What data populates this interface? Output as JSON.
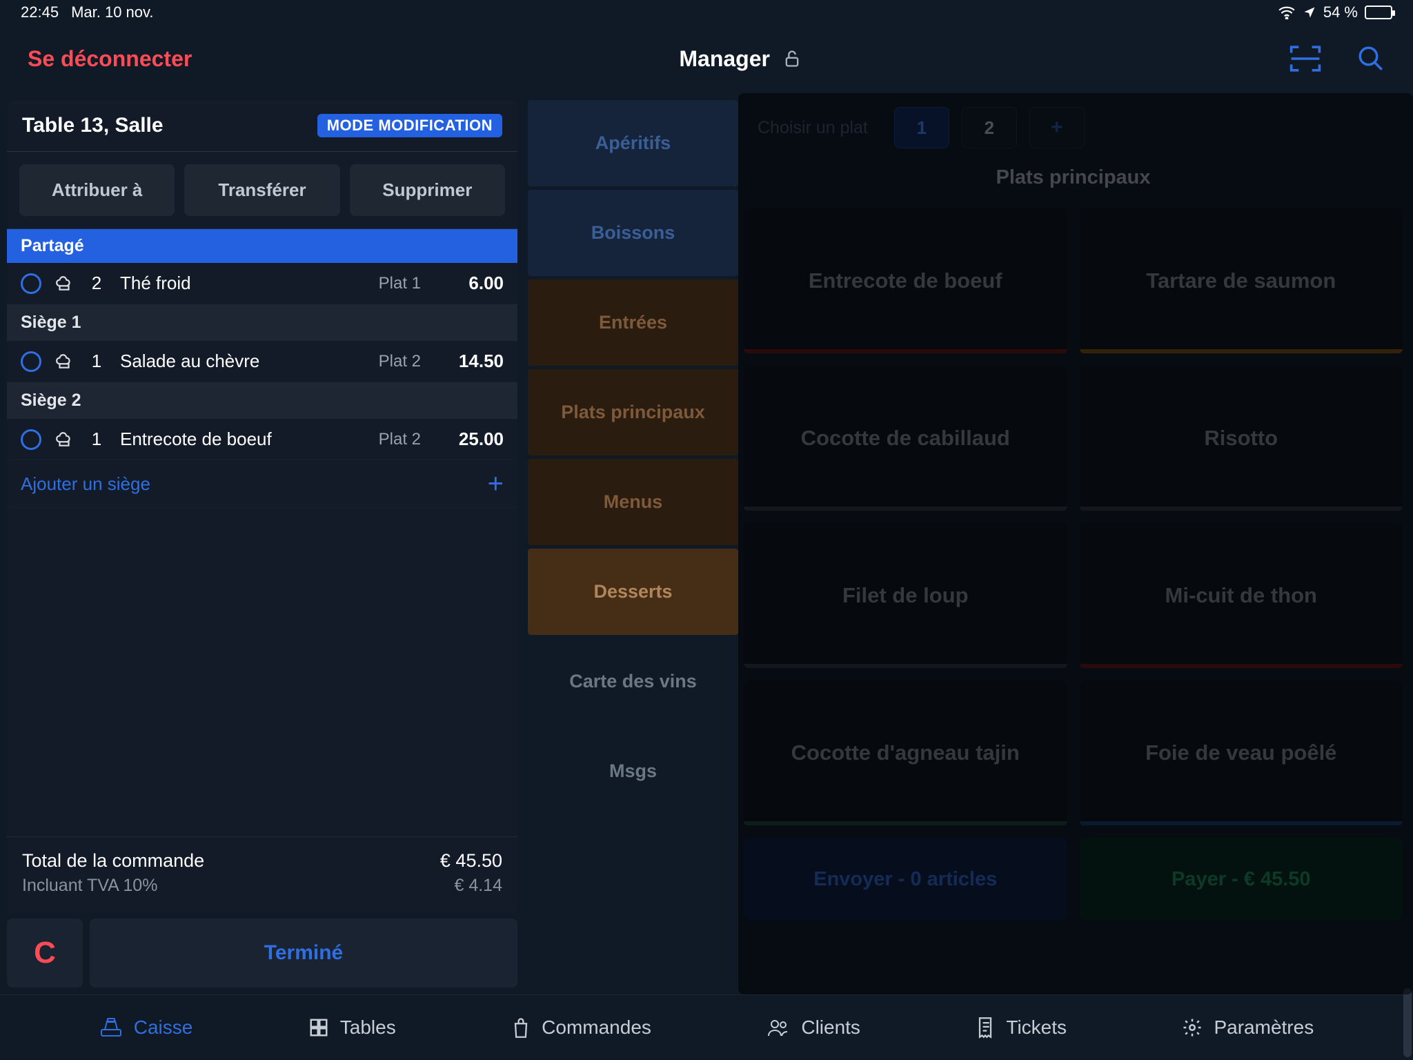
{
  "status": {
    "time": "22:45",
    "date": "Mar. 10 nov.",
    "battery": "54 %"
  },
  "header": {
    "logout": "Se déconnecter",
    "title": "Manager"
  },
  "order": {
    "table": "Table 13, Salle",
    "badge": "MODE MODIFICATION",
    "actions": {
      "assign": "Attribuer à",
      "transfer": "Transférer",
      "delete": "Supprimer"
    },
    "shared_label": "Partagé",
    "seat1_label": "Siège 1",
    "seat2_label": "Siège 2",
    "lines": {
      "shared": {
        "qty": "2",
        "name": "Thé froid",
        "course": "Plat 1",
        "price": "6.00"
      },
      "seat1": {
        "qty": "1",
        "name": "Salade au chèvre",
        "course": "Plat 2",
        "price": "14.50"
      },
      "seat2": {
        "qty": "1",
        "name": "Entrecote de boeuf",
        "course": "Plat 2",
        "price": "25.00"
      }
    },
    "add_seat": "Ajouter un siège",
    "total_label": "Total de la commande",
    "total_value": "€ 45.50",
    "vat_label": "Incluant TVA 10%",
    "vat_value": "€ 4.14",
    "c": "C",
    "done": "Terminé"
  },
  "categories": {
    "aperitifs": "Apéritifs",
    "boissons": "Boissons",
    "entrees": "Entrées",
    "plats": "Plats principaux",
    "menus": "Menus",
    "desserts": "Desserts",
    "vins": "Carte des vins",
    "msgs": "Msgs"
  },
  "right": {
    "choose": "Choisir un plat",
    "course1": "1",
    "course2": "2",
    "section_title": "Plats principaux",
    "dishes": {
      "d1": "Entrecote de boeuf",
      "d2": "Tartare de saumon",
      "d3": "Cocotte de cabillaud",
      "d4": "Risotto",
      "d5": "Filet de loup",
      "d6": "Mi-cuit de thon",
      "d7": "Cocotte d'agneau tajin",
      "d8": "Foie de veau poêlé"
    },
    "send": "Envoyer - 0 articles",
    "pay": "Payer - € 45.50"
  },
  "nav": {
    "caisse": "Caisse",
    "tables": "Tables",
    "commandes": "Commandes",
    "clients": "Clients",
    "tickets": "Tickets",
    "parametres": "Paramètres"
  }
}
